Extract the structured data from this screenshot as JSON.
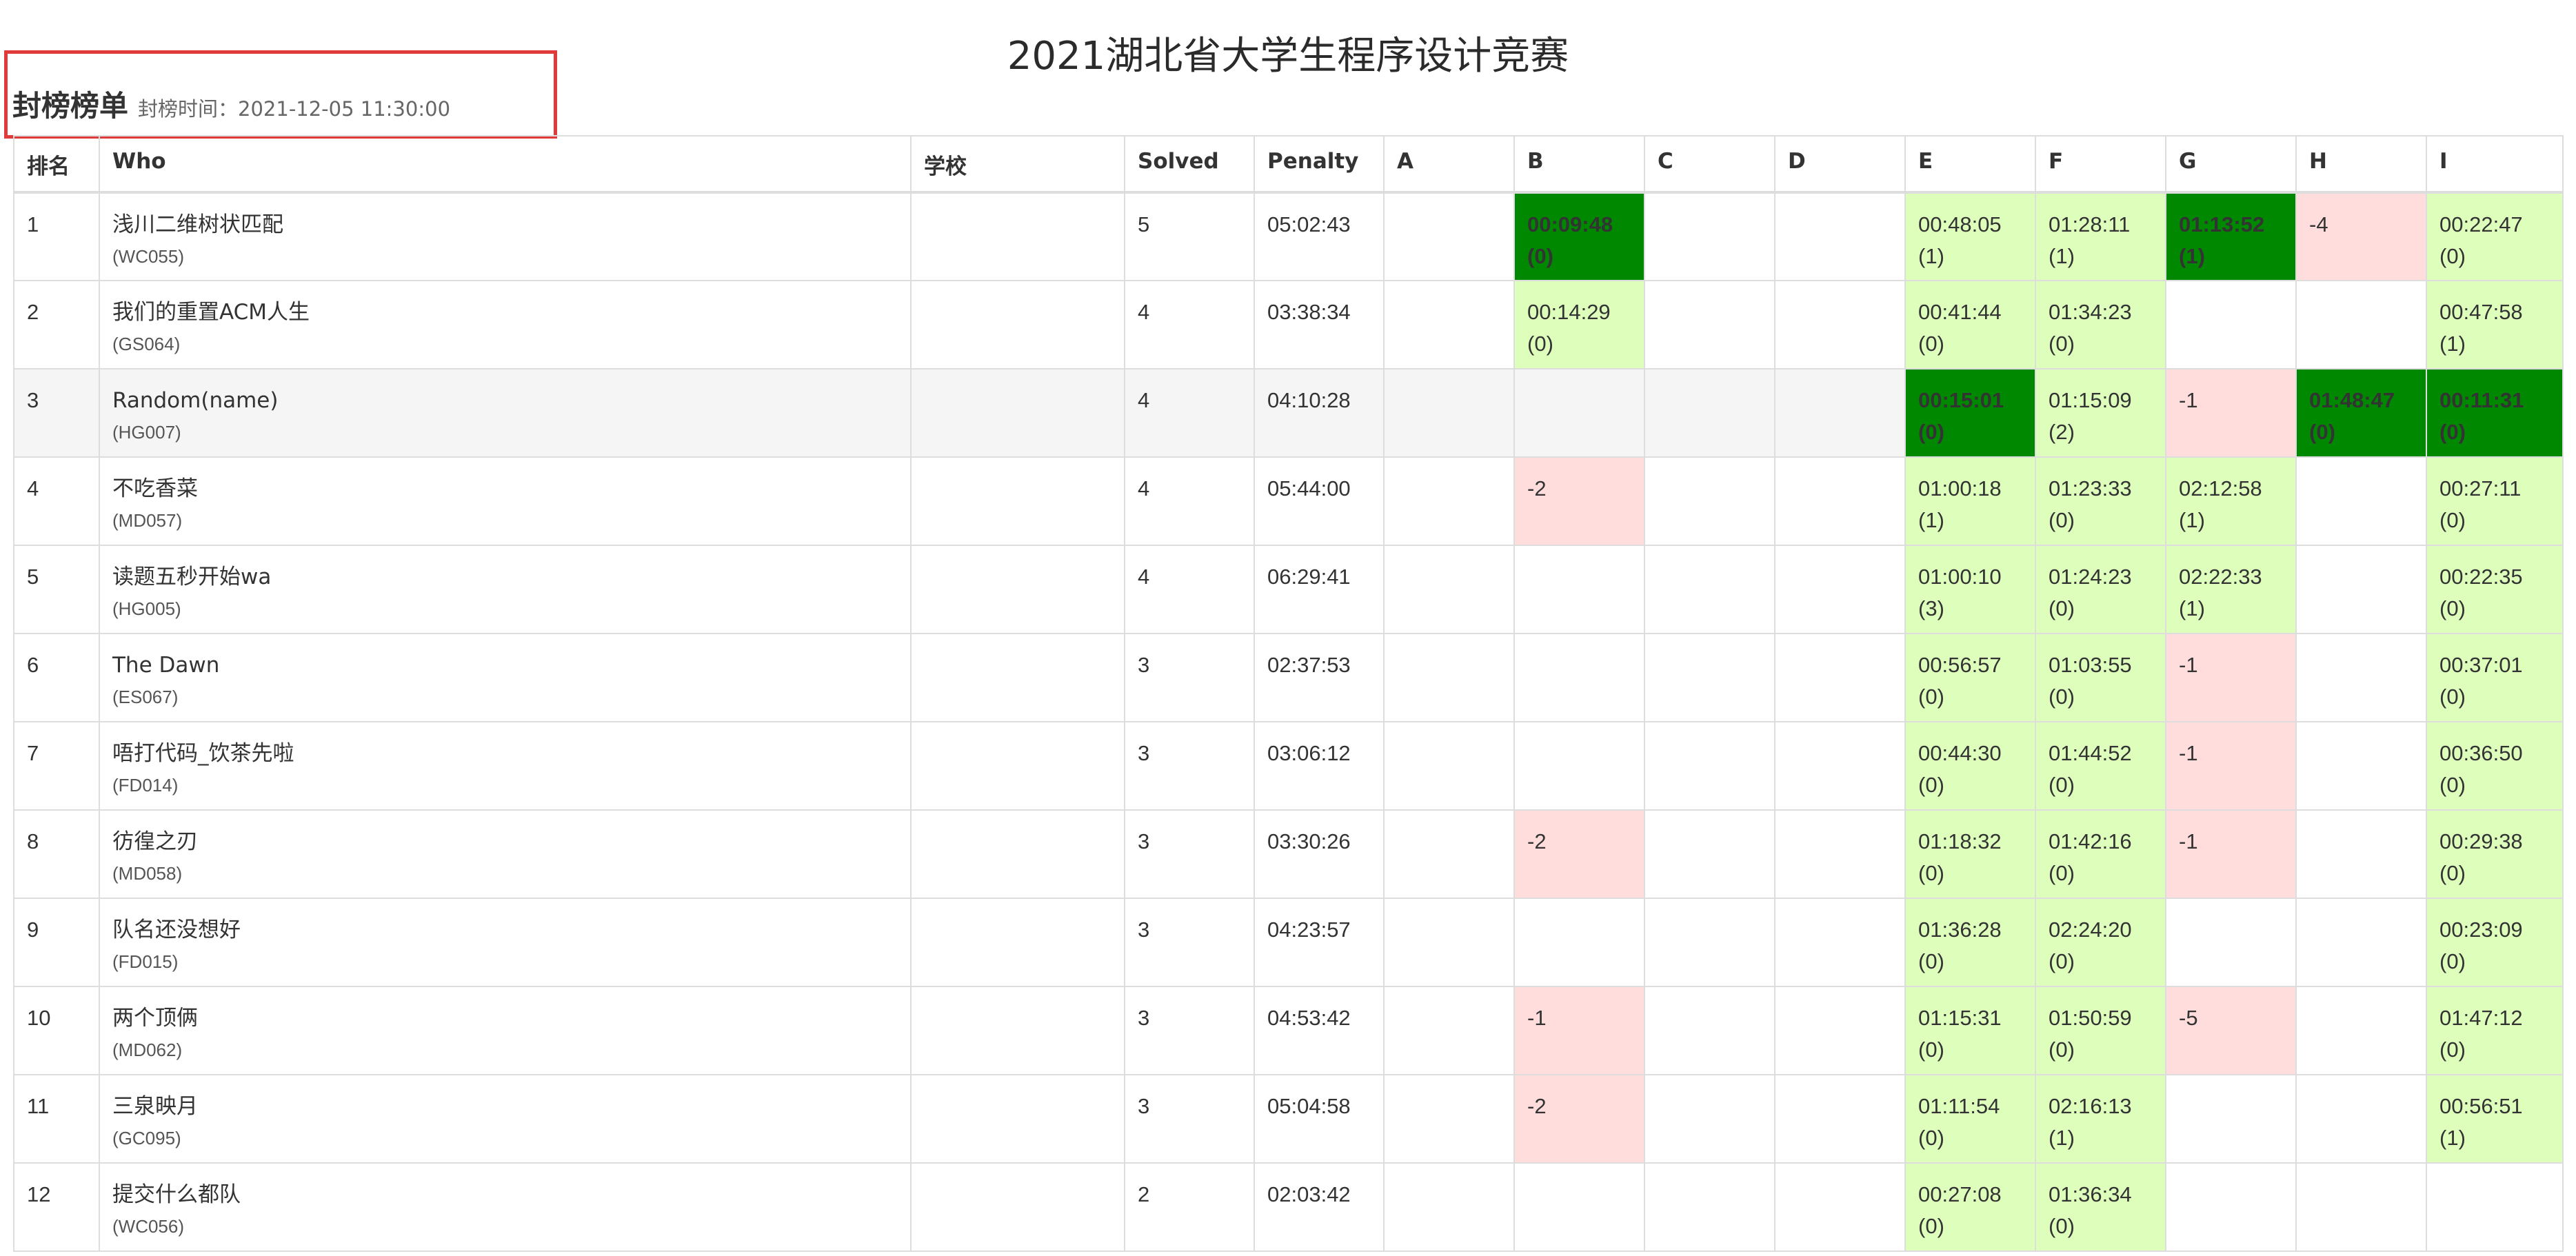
{
  "title": "2021湖北省大学生程序设计竞赛",
  "freeze": {
    "label": "封榜榜单",
    "time_text": "封榜时间：2021-12-05 11:30:00"
  },
  "columns": [
    "排名",
    "Who",
    "学校",
    "Solved",
    "Penalty",
    "A",
    "B",
    "C",
    "D",
    "E",
    "F",
    "G",
    "H",
    "I"
  ],
  "rows": [
    {
      "rank": "1",
      "name": "浅川二维树状匹配",
      "id": "(WC055)",
      "school": "",
      "solved": "5",
      "penalty": "05:02:43",
      "cells": [
        {
          "s": "none",
          "t": "",
          "a": ""
        },
        {
          "s": "fb",
          "t": "00:09:48",
          "a": "(0)"
        },
        {
          "s": "none",
          "t": "",
          "a": ""
        },
        {
          "s": "none",
          "t": "",
          "a": ""
        },
        {
          "s": "ac",
          "t": "00:48:05",
          "a": "(1)"
        },
        {
          "s": "ac",
          "t": "01:28:11",
          "a": "(1)"
        },
        {
          "s": "fb",
          "t": "01:13:52",
          "a": "(1)"
        },
        {
          "s": "wa",
          "t": "-4",
          "a": ""
        },
        {
          "s": "ac",
          "t": "00:22:47",
          "a": "(0)"
        }
      ]
    },
    {
      "rank": "2",
      "name": "我们的重置ACM人生",
      "id": "(GS064)",
      "school": "",
      "solved": "4",
      "penalty": "03:38:34",
      "cells": [
        {
          "s": "none",
          "t": "",
          "a": ""
        },
        {
          "s": "ac",
          "t": "00:14:29",
          "a": "(0)"
        },
        {
          "s": "none",
          "t": "",
          "a": ""
        },
        {
          "s": "none",
          "t": "",
          "a": ""
        },
        {
          "s": "ac",
          "t": "00:41:44",
          "a": "(0)"
        },
        {
          "s": "ac",
          "t": "01:34:23",
          "a": "(0)"
        },
        {
          "s": "none",
          "t": "",
          "a": ""
        },
        {
          "s": "none",
          "t": "",
          "a": ""
        },
        {
          "s": "ac",
          "t": "00:47:58",
          "a": "(1)"
        }
      ]
    },
    {
      "rank": "3",
      "name": "Random(name)",
      "id": "(HG007)",
      "school": "",
      "solved": "4",
      "penalty": "04:10:28",
      "cells": [
        {
          "s": "none",
          "t": "",
          "a": ""
        },
        {
          "s": "none",
          "t": "",
          "a": ""
        },
        {
          "s": "none",
          "t": "",
          "a": ""
        },
        {
          "s": "none",
          "t": "",
          "a": ""
        },
        {
          "s": "fb",
          "t": "00:15:01",
          "a": "(0)"
        },
        {
          "s": "ac",
          "t": "01:15:09",
          "a": "(2)"
        },
        {
          "s": "wa",
          "t": "-1",
          "a": ""
        },
        {
          "s": "fb",
          "t": "01:48:47",
          "a": "(0)"
        },
        {
          "s": "fb",
          "t": "00:11:31",
          "a": "(0)"
        }
      ]
    },
    {
      "rank": "4",
      "name": "不吃香菜",
      "id": "(MD057)",
      "school": "",
      "solved": "4",
      "penalty": "05:44:00",
      "cells": [
        {
          "s": "none",
          "t": "",
          "a": ""
        },
        {
          "s": "wa",
          "t": "-2",
          "a": ""
        },
        {
          "s": "none",
          "t": "",
          "a": ""
        },
        {
          "s": "none",
          "t": "",
          "a": ""
        },
        {
          "s": "ac",
          "t": "01:00:18",
          "a": "(1)"
        },
        {
          "s": "ac",
          "t": "01:23:33",
          "a": "(0)"
        },
        {
          "s": "ac",
          "t": "02:12:58",
          "a": "(1)"
        },
        {
          "s": "none",
          "t": "",
          "a": ""
        },
        {
          "s": "ac",
          "t": "00:27:11",
          "a": "(0)"
        }
      ]
    },
    {
      "rank": "5",
      "name": "读题五秒开始wa",
      "id": "(HG005)",
      "school": "",
      "solved": "4",
      "penalty": "06:29:41",
      "cells": [
        {
          "s": "none",
          "t": "",
          "a": ""
        },
        {
          "s": "none",
          "t": "",
          "a": ""
        },
        {
          "s": "none",
          "t": "",
          "a": ""
        },
        {
          "s": "none",
          "t": "",
          "a": ""
        },
        {
          "s": "ac",
          "t": "01:00:10",
          "a": "(3)"
        },
        {
          "s": "ac",
          "t": "01:24:23",
          "a": "(0)"
        },
        {
          "s": "ac",
          "t": "02:22:33",
          "a": "(1)"
        },
        {
          "s": "none",
          "t": "",
          "a": ""
        },
        {
          "s": "ac",
          "t": "00:22:35",
          "a": "(0)"
        }
      ]
    },
    {
      "rank": "6",
      "name": "The Dawn",
      "id": "(ES067)",
      "school": "",
      "solved": "3",
      "penalty": "02:37:53",
      "cells": [
        {
          "s": "none",
          "t": "",
          "a": ""
        },
        {
          "s": "none",
          "t": "",
          "a": ""
        },
        {
          "s": "none",
          "t": "",
          "a": ""
        },
        {
          "s": "none",
          "t": "",
          "a": ""
        },
        {
          "s": "ac",
          "t": "00:56:57",
          "a": "(0)"
        },
        {
          "s": "ac",
          "t": "01:03:55",
          "a": "(0)"
        },
        {
          "s": "wa",
          "t": "-1",
          "a": ""
        },
        {
          "s": "none",
          "t": "",
          "a": ""
        },
        {
          "s": "ac",
          "t": "00:37:01",
          "a": "(0)"
        }
      ]
    },
    {
      "rank": "7",
      "name": "唔打代码_饮茶先啦",
      "id": "(FD014)",
      "school": "",
      "solved": "3",
      "penalty": "03:06:12",
      "cells": [
        {
          "s": "none",
          "t": "",
          "a": ""
        },
        {
          "s": "none",
          "t": "",
          "a": ""
        },
        {
          "s": "none",
          "t": "",
          "a": ""
        },
        {
          "s": "none",
          "t": "",
          "a": ""
        },
        {
          "s": "ac",
          "t": "00:44:30",
          "a": "(0)"
        },
        {
          "s": "ac",
          "t": "01:44:52",
          "a": "(0)"
        },
        {
          "s": "wa",
          "t": "-1",
          "a": ""
        },
        {
          "s": "none",
          "t": "",
          "a": ""
        },
        {
          "s": "ac",
          "t": "00:36:50",
          "a": "(0)"
        }
      ]
    },
    {
      "rank": "8",
      "name": "彷徨之刃",
      "id": "(MD058)",
      "school": "",
      "solved": "3",
      "penalty": "03:30:26",
      "cells": [
        {
          "s": "none",
          "t": "",
          "a": ""
        },
        {
          "s": "wa",
          "t": "-2",
          "a": ""
        },
        {
          "s": "none",
          "t": "",
          "a": ""
        },
        {
          "s": "none",
          "t": "",
          "a": ""
        },
        {
          "s": "ac",
          "t": "01:18:32",
          "a": "(0)"
        },
        {
          "s": "ac",
          "t": "01:42:16",
          "a": "(0)"
        },
        {
          "s": "wa",
          "t": "-1",
          "a": ""
        },
        {
          "s": "none",
          "t": "",
          "a": ""
        },
        {
          "s": "ac",
          "t": "00:29:38",
          "a": "(0)"
        }
      ]
    },
    {
      "rank": "9",
      "name": "队名还没想好",
      "id": "(FD015)",
      "school": "",
      "solved": "3",
      "penalty": "04:23:57",
      "cells": [
        {
          "s": "none",
          "t": "",
          "a": ""
        },
        {
          "s": "none",
          "t": "",
          "a": ""
        },
        {
          "s": "none",
          "t": "",
          "a": ""
        },
        {
          "s": "none",
          "t": "",
          "a": ""
        },
        {
          "s": "ac",
          "t": "01:36:28",
          "a": "(0)"
        },
        {
          "s": "ac",
          "t": "02:24:20",
          "a": "(0)"
        },
        {
          "s": "none",
          "t": "",
          "a": ""
        },
        {
          "s": "none",
          "t": "",
          "a": ""
        },
        {
          "s": "ac",
          "t": "00:23:09",
          "a": "(0)"
        }
      ]
    },
    {
      "rank": "10",
      "name": "两个顶俩",
      "id": "(MD062)",
      "school": "",
      "solved": "3",
      "penalty": "04:53:42",
      "cells": [
        {
          "s": "none",
          "t": "",
          "a": ""
        },
        {
          "s": "wa",
          "t": "-1",
          "a": ""
        },
        {
          "s": "none",
          "t": "",
          "a": ""
        },
        {
          "s": "none",
          "t": "",
          "a": ""
        },
        {
          "s": "ac",
          "t": "01:15:31",
          "a": "(0)"
        },
        {
          "s": "ac",
          "t": "01:50:59",
          "a": "(0)"
        },
        {
          "s": "wa",
          "t": "-5",
          "a": ""
        },
        {
          "s": "none",
          "t": "",
          "a": ""
        },
        {
          "s": "ac",
          "t": "01:47:12",
          "a": "(0)"
        }
      ]
    },
    {
      "rank": "11",
      "name": "三泉映月",
      "id": "(GC095)",
      "school": "",
      "solved": "3",
      "penalty": "05:04:58",
      "cells": [
        {
          "s": "none",
          "t": "",
          "a": ""
        },
        {
          "s": "wa",
          "t": "-2",
          "a": ""
        },
        {
          "s": "none",
          "t": "",
          "a": ""
        },
        {
          "s": "none",
          "t": "",
          "a": ""
        },
        {
          "s": "ac",
          "t": "01:11:54",
          "a": "(0)"
        },
        {
          "s": "ac",
          "t": "02:16:13",
          "a": "(1)"
        },
        {
          "s": "none",
          "t": "",
          "a": ""
        },
        {
          "s": "none",
          "t": "",
          "a": ""
        },
        {
          "s": "ac",
          "t": "00:56:51",
          "a": "(1)"
        }
      ]
    },
    {
      "rank": "12",
      "name": "提交什么都队",
      "id": "(WC056)",
      "school": "",
      "solved": "2",
      "penalty": "02:03:42",
      "cells": [
        {
          "s": "none",
          "t": "",
          "a": ""
        },
        {
          "s": "none",
          "t": "",
          "a": ""
        },
        {
          "s": "none",
          "t": "",
          "a": ""
        },
        {
          "s": "none",
          "t": "",
          "a": ""
        },
        {
          "s": "ac",
          "t": "00:27:08",
          "a": "(0)"
        },
        {
          "s": "ac",
          "t": "01:36:34",
          "a": "(0)"
        },
        {
          "s": "none",
          "t": "",
          "a": ""
        },
        {
          "s": "none",
          "t": "",
          "a": ""
        },
        {
          "s": "pending",
          "t": "",
          "a": ""
        }
      ]
    }
  ],
  "colors": {
    "first_blood": "#008800",
    "accepted": "#ddffbb",
    "wrong": "#ffdddd",
    "highlight_box": "#e03a3a"
  }
}
